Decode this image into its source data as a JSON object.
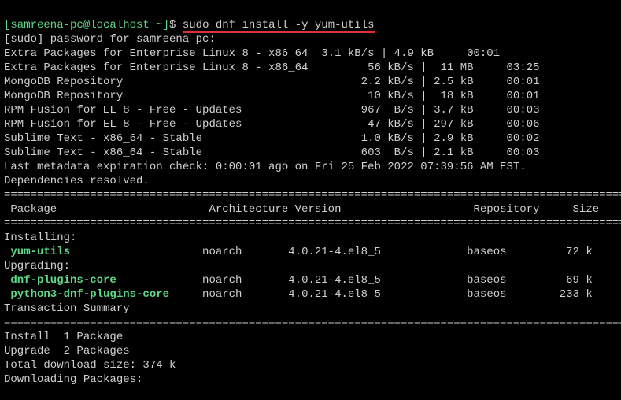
{
  "prompt": {
    "user_host": "[samreena-pc@localhost ~]",
    "symbol": "$",
    "command": "sudo dnf install -y yum-utils"
  },
  "sudo_line": "[sudo] password for samreena-pc:",
  "repos": [
    "Extra Packages for Enterprise Linux 8 - x86_64  3.1 kB/s | 4.9 kB     00:01",
    "Extra Packages for Enterprise Linux 8 - x86_64         56 kB/s |  11 MB     03:25",
    "MongoDB Repository                                    2.2 kB/s | 2.5 kB     00:01",
    "MongoDB Repository                                     10 kB/s |  18 kB     00:01",
    "RPM Fusion for EL 8 - Free - Updates                  967  B/s | 3.7 kB     00:03",
    "RPM Fusion for EL 8 - Free - Updates                   47 kB/s | 297 kB     00:06",
    "Sublime Text - x86_64 - Stable                        1.0 kB/s | 2.9 kB     00:02",
    "Sublime Text - x86_64 - Stable                        603  B/s | 2.1 kB     00:03"
  ],
  "metadata_line": "Last metadata expiration check: 0:00:01 ago on Fri 25 Feb 2022 07:39:56 AM EST.",
  "deps_line": "Dependencies resolved.",
  "divider": "================================================================================================",
  "header": " Package                       Architecture Version                    Repository     Size",
  "installing_label": "Installing:",
  "install_pkgs": [
    {
      "name": " yum-utils",
      "rest": "                    noarch       4.0.21-4.el8_5             baseos         72 k"
    }
  ],
  "upgrading_label": "Upgrading:",
  "upgrade_pkgs": [
    {
      "name": " dnf-plugins-core",
      "rest": "             noarch       4.0.21-4.el8_5             baseos         69 k"
    },
    {
      "name": " python3-dnf-plugins-core",
      "rest": "     noarch       4.0.21-4.el8_5             baseos        233 k"
    }
  ],
  "blank": "",
  "txn_summary_label": "Transaction Summary",
  "install_count": "Install  1 Package",
  "upgrade_count": "Upgrade  2 Packages",
  "total_size": "Total download size: 374 k",
  "downloading": "Downloading Packages:"
}
